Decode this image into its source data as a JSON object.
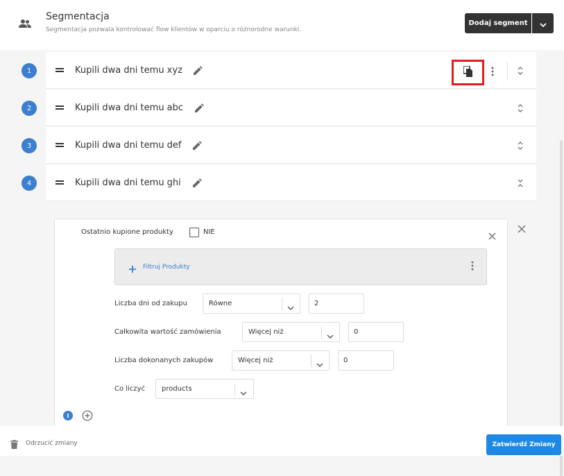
{
  "header": {
    "icon": "people-icon",
    "title": "Segmentacja",
    "subtitle": "Segmentacja pozwala kontrolować flow klientów w oparciu o różnorodne warunki.",
    "add_segment_label": "Dodaj segment"
  },
  "segments": [
    {
      "number": "1",
      "title": "Kupili dwa dni temu xyz"
    },
    {
      "number": "2",
      "title": "Kupili dwa dni temu abc"
    },
    {
      "number": "3",
      "title": "Kupili dwa dni temu def"
    },
    {
      "number": "4",
      "title": "Kupili dwa dni temu ghi"
    }
  ],
  "condition": {
    "label": "Ostatnio kupione produkty",
    "checkbox_label": "NIE",
    "filter_label": "Filtruj Produkty",
    "fields": [
      {
        "label": "Liczba dni od zakupu",
        "select": "Równe",
        "value": "2"
      },
      {
        "label": "Całkowita wartość zamówienia",
        "select": "Więcej niż",
        "value": "0"
      },
      {
        "label": "Liczba dokonanych zakupów",
        "select": "Więcej niż",
        "value": "0"
      },
      {
        "label": "Co liczyć",
        "select": "products"
      }
    ],
    "info_badge": "I"
  },
  "footer": {
    "discard_label": "Odrzucić zmiany",
    "confirm_label": "Zatwierdź Zmiany"
  },
  "colors": {
    "accent": "#3b7fce",
    "primary_button": "#1e88e5",
    "dark_button": "#333333",
    "highlight": "#e01c1c"
  }
}
